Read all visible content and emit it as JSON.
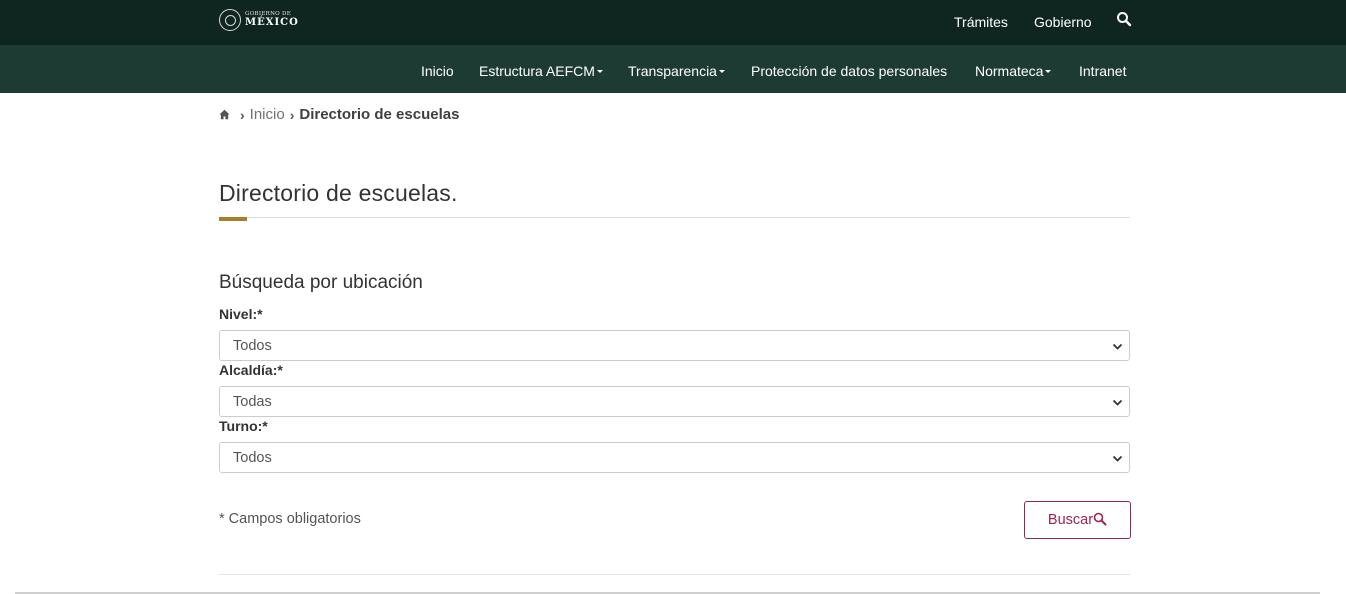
{
  "header": {
    "logo": {
      "small_text": "GOBIERNO DE",
      "big_text": "MÉXICO"
    },
    "links": [
      "Trámites",
      "Gobierno"
    ],
    "search_icon": "search-icon",
    "colors": {
      "topbar": "#0f2620",
      "navbar": "#1d3b33"
    }
  },
  "nav": {
    "items": [
      {
        "label": "Inicio"
      },
      {
        "label": "Estructura AEFCM"
      },
      {
        "label": "Transparencia"
      },
      {
        "label": "Protección de datos personales"
      },
      {
        "label": "Normateca"
      },
      {
        "label": "Intranet"
      }
    ]
  },
  "breadcrumb": {
    "home_icon": "home-icon",
    "link": "Inicio",
    "current": "Directorio de escuelas"
  },
  "page": {
    "title": "Directorio de escuelas.",
    "accent_color": "#a57f2c"
  },
  "form": {
    "heading": "Búsqueda por ubicación",
    "fields": [
      {
        "label": "Nivel:*",
        "value": "Todos"
      },
      {
        "label": "Alcaldía:*",
        "value": "Todas"
      },
      {
        "label": "Turno:*",
        "value": "Todos"
      }
    ],
    "required_note": "* Campos obligatorios",
    "submit_label": "Buscar",
    "submit_color": "#9d2449"
  }
}
